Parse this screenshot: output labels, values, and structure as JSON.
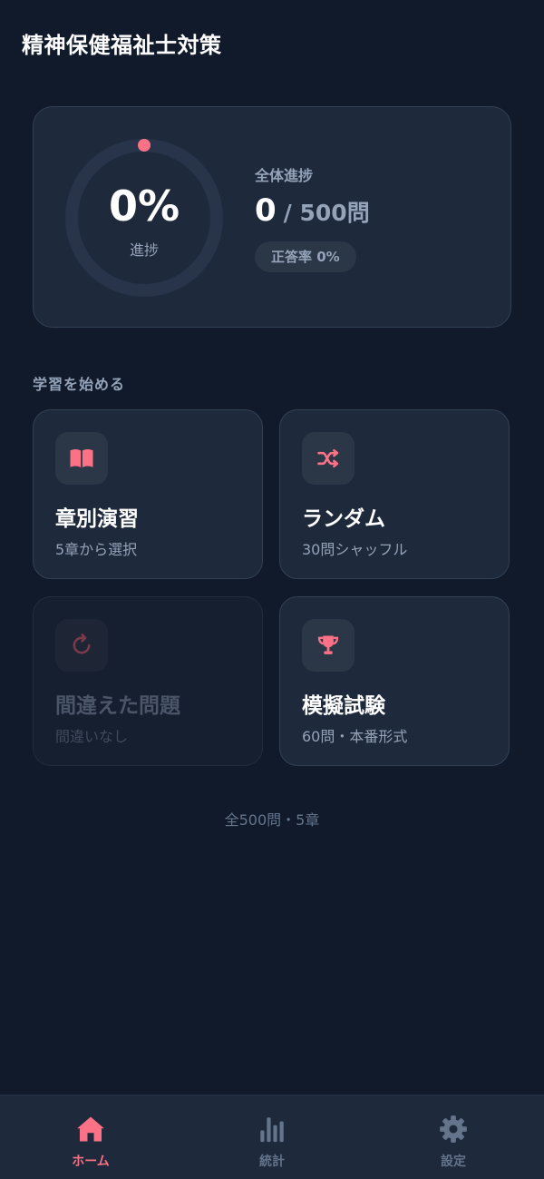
{
  "app": {
    "title": "精神保健福祉士対策"
  },
  "progress": {
    "percent_text": "0%",
    "fraction": 0,
    "ring_label": "進捗",
    "overall_label": "全体進捗",
    "done": "0",
    "total": "/ 500問",
    "accuracy": "正答率 0%"
  },
  "section": {
    "title": "学習を始める"
  },
  "modes": [
    {
      "title": "章別演習",
      "subtitle": "5章から選択",
      "icon": "book-icon",
      "enabled": true
    },
    {
      "title": "ランダム",
      "subtitle": "30問シャッフル",
      "icon": "shuffle-icon",
      "enabled": true
    },
    {
      "title": "間違えた問題",
      "subtitle": "間違いなし",
      "icon": "retry-icon",
      "enabled": false
    },
    {
      "title": "模擬試験",
      "subtitle": "60問・本番形式",
      "icon": "trophy-icon",
      "enabled": true
    }
  ],
  "footer": {
    "note": "全500問・5章"
  },
  "nav": {
    "items": [
      {
        "label": "ホーム",
        "icon": "home-icon",
        "active": true
      },
      {
        "label": "統計",
        "icon": "bar-chart-icon",
        "active": false
      },
      {
        "label": "設定",
        "icon": "gear-icon",
        "active": false
      }
    ]
  },
  "colors": {
    "background": "#111a2b",
    "card": "#1e293b",
    "accent": "#fb7185",
    "muted": "#94a3b8"
  }
}
